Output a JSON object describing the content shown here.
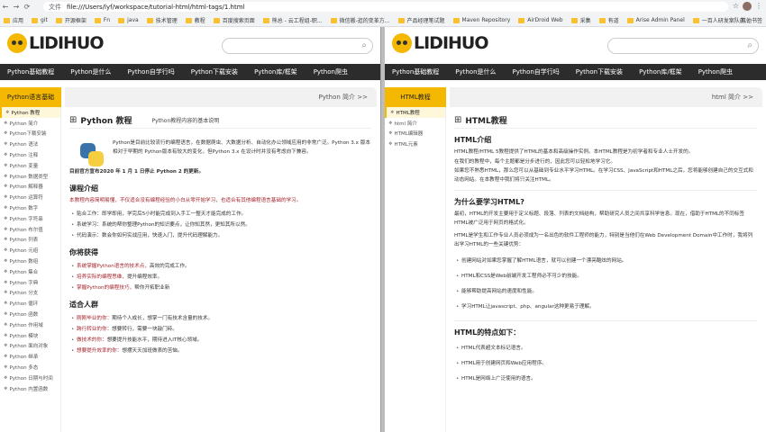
{
  "browser": {
    "address_label": "文件",
    "url": "file:///Users/lyf/workspace/tutorial-html/html-tags/1.html",
    "bookmarks": [
      "应用",
      "git",
      "开源框架",
      "Fn",
      "java",
      "技术管理",
      "教程",
      "百度搜索页面",
      "熊总 - 云工程组-职...",
      "微信搬-逛的变革方...",
      "产品经理笔试题",
      "Maven Repository",
      "AirDroid Web",
      "采集",
      "有道",
      "Arise Admin Panel",
      "一百人研发案队的..."
    ],
    "bookmarks_right": "其他书签"
  },
  "site": {
    "logo_text": "LIDIHUO",
    "search_icon": "search-icon",
    "nav": [
      "Python基础教程",
      "Python是什么",
      "Python自学行吗",
      "Python下载安装",
      "Python库/框架",
      "Python爬虫"
    ]
  },
  "left": {
    "category": "Python语言基础",
    "intro_link": "Python 简介 >>",
    "sidebar": [
      "Python 教程",
      "Python 简介",
      "Python下载安装",
      "Python 语法",
      "Python 注释",
      "Python 变量",
      "Python 数据类型",
      "Python 解释器",
      "Python 运算符",
      "Python 数字",
      "Python 字符串",
      "Python 布尔值",
      "Python 列表",
      "Python 元组",
      "Python 数组",
      "Python 集合",
      "Python 字典",
      "Python 分支",
      "Python 循环",
      "Python 函数",
      "Python 作用域",
      "Python 模块",
      "Python 面向对象",
      "Python 继承",
      "Python 多态",
      "Python 日期与时间",
      "Python 内置函数"
    ],
    "title": "Python 教程",
    "subtitle": "Python教程内容的基本说明",
    "intro_p": "Python是目前比较流行的编程语言，在数据爬虫、大数据分析、自动化办公领域应用的非常广泛。Python 3.x 版本相对于早期的 Python版本有较大的变化，但Python 3.x 在设计时并没有考虑向下兼容。",
    "announce": "目前官方宣布2020 年 1 月 1 日停止 Python 2 的更新。",
    "s1_title": "课程介绍",
    "s1_red": "本教程内容简明易懂，不仅适合没有编程经验的小白从零开始学习，也适合有其他编程语言基础的学习。",
    "s1_items": [
      "贴合工作：即学即用，学完后5小时能完成到入手工一整天才能完成的工作。",
      "系统学习：系统的帮你整理Python的知识要点，让你知其然，更知其所以然。",
      "代码演示：数会你如何实战应用，快速入门，提升代码理解能力。"
    ],
    "s2_title": "你将获得",
    "s2_items": [
      {
        "red": "系统掌握Python语言的技术点，",
        "rest": "高效的完成工作。"
      },
      {
        "red": "培养实际的编程思维，",
        "rest": "提升编程效率。"
      },
      {
        "red": "掌握Python的编程技巧，",
        "rest": "帮你开拓职业新"
      }
    ],
    "s3_title": "适合人群",
    "s3_items": [
      {
        "red": "刚刚毕业的你：",
        "rest": "期待个人成长，想掌一门有技术含量的技术。"
      },
      {
        "red": "跨行转业的你：",
        "rest": "想要转行，需要一块敲门砖。"
      },
      {
        "red": "做技术的你：",
        "rest": "想要提升技能水平，期待进入IT核心领域。"
      },
      {
        "red": "想要提升效率的你：",
        "rest": "想摆天天加班做表的苦恼。"
      }
    ]
  },
  "right": {
    "category": "HTML教程",
    "intro_link": "html 简介 >>",
    "sidebar": [
      "HTML教程",
      "html 简介",
      "HTML编辑器",
      "HTML元素"
    ],
    "title": "HTML教程",
    "s1_title": "HTML介绍",
    "s1_paras": [
      "HTML教程/HTML 5教程提供了HTML的基本和高级操作实例。本HTML教程是为初学者和专业人士开发的。",
      "在我们的教程中，每个主题都是分步进行的，因此您可以轻松地学习它。",
      "如果您不熟悉HTML，那么您可以从基础到专业水平学习HTML。在学习CSS、JavaScript和HTML之后，您将能够创建自己的交互式和动态网站。在本教程中我们将只关注HTML。"
    ],
    "s2_title": "为什么要学习HTML?",
    "s2_paras": [
      "最初，HTML的开发主要用于定义标题、段落、列表的文档结构，帮助研究人员之间共享科学信息。现在，借助于HTML的不同标签HTML被广泛用于网页的格式化。",
      "HTML是学生和工作专业人员必须成为一名出色的软件工程师的能力，特别是当他们在Web Development Domain中工作时，我将列出学习HTML的一些关键优势："
    ],
    "s2_items": [
      "创建网站对如果您掌握了解HTML语言，就可以创建一个漂亮酷炫的网站。",
      "HTML和CSS是Web前端开发工程师必不可少的技能。",
      "能够帮助提高网站的速度和性能。",
      "学习HTML让javascript、php、angular这种更易于理解。"
    ],
    "s3_title": "HTML的特点如下：",
    "s3_items": [
      "HTML代表超文本标记语言。",
      "HTML用于创建网页和Web应用程序。",
      "HTML是网络上广泛使用的语言。"
    ]
  }
}
